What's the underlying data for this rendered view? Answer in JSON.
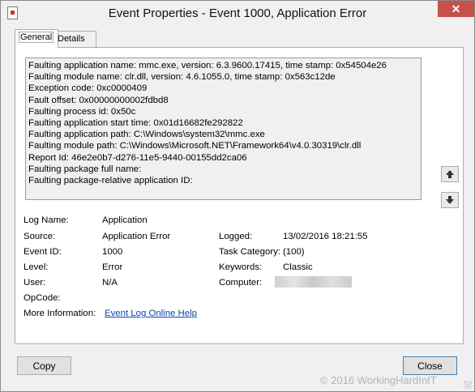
{
  "window": {
    "title": "Event Properties - Event 1000, Application Error",
    "close_glyph": "✕"
  },
  "tabs": [
    {
      "label": "General",
      "active": true
    },
    {
      "label": "Details",
      "active": false
    }
  ],
  "description_lines": [
    "Faulting application name: mmc.exe, version: 6.3.9600.17415, time stamp: 0x54504e26",
    "Faulting module name: clr.dll, version: 4.6.1055.0, time stamp: 0x563c12de",
    "Exception code: 0xc0000409",
    "Fault offset: 0x00000000002fdbd8",
    "Faulting process id: 0x50c",
    "Faulting application start time: 0x01d16682fe292822",
    "Faulting application path: C:\\Windows\\system32\\mmc.exe",
    "Faulting module path: C:\\Windows\\Microsoft.NET\\Framework64\\v4.0.30319\\clr.dll",
    "Report Id: 46e2e0b7-d276-11e5-9440-00155dd2ca06",
    "Faulting package full name:",
    "Faulting package-relative application ID:"
  ],
  "fields": {
    "log_name_label": "Log Name:",
    "log_name_value": "Application",
    "source_label": "Source:",
    "source_value": "Application Error",
    "logged_label": "Logged:",
    "logged_value": "13/02/2016 18:21:55",
    "event_id_label": "Event ID:",
    "event_id_value": "1000",
    "task_category_label": "Task Category:",
    "task_category_value": "(100)",
    "level_label": "Level:",
    "level_value": "Error",
    "keywords_label": "Keywords:",
    "keywords_value": "Classic",
    "user_label": "User:",
    "user_value": "N/A",
    "computer_label": "Computer:",
    "opcode_label": "OpCode:",
    "more_info_label": "More Information:",
    "more_info_link": "Event Log Online Help"
  },
  "buttons": {
    "copy": "Copy",
    "close": "Close"
  },
  "watermark": "© 2016 WorkingHardInIT",
  "colors": {
    "close_button": "#c7504b",
    "link": "#0645ad"
  }
}
